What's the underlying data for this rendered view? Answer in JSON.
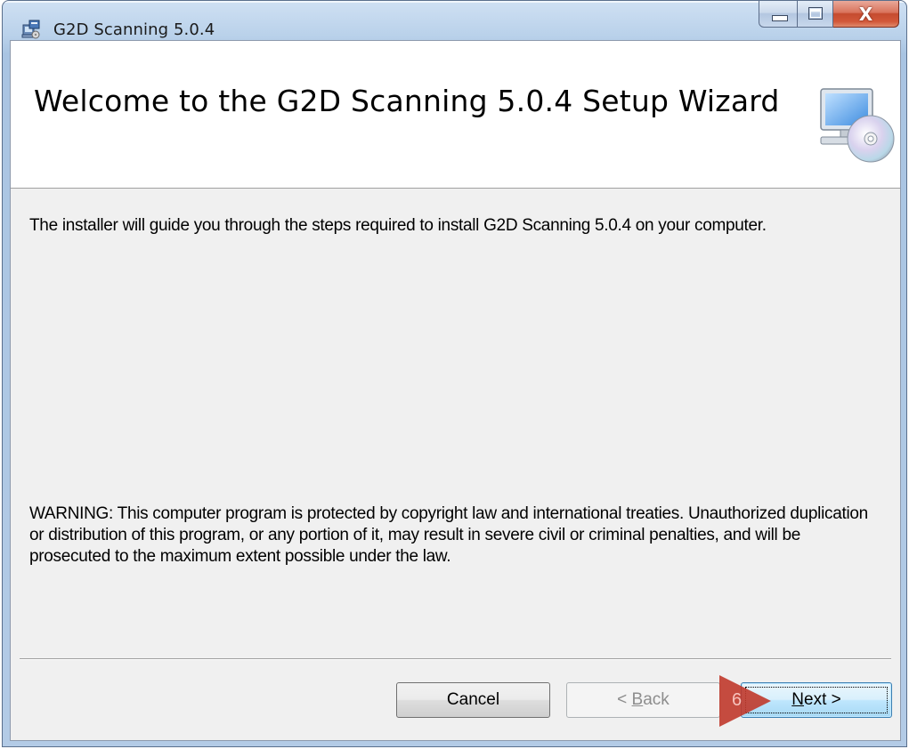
{
  "window": {
    "title": "G2D Scanning 5.0.4",
    "close_glyph": "X"
  },
  "banner": {
    "title": "Welcome to the G2D Scanning 5.0.4 Setup Wizard",
    "icon": "computer-with-cd-icon"
  },
  "body": {
    "intro": "The installer will guide you through the steps required to install G2D Scanning 5.0.4 on your computer.",
    "warning": "WARNING: This computer program is protected by copyright law and international treaties. Unauthorized duplication or distribution of this program, or any portion of it, may result in severe civil or criminal penalties, and will be prosecuted to the maximum extent possible under the law."
  },
  "buttons": {
    "cancel": "Cancel",
    "back_prefix": "< ",
    "back_mnemonic": "B",
    "back_rest": "ack",
    "next_mnemonic": "N",
    "next_rest": "ext >"
  },
  "annotation": {
    "step_number": "6",
    "color": "#c0392b"
  },
  "colors": {
    "client_bg": "#f0f0f0",
    "banner_bg": "#ffffff",
    "next_border": "#3c7fb1",
    "close_button": "#c54b2f"
  }
}
